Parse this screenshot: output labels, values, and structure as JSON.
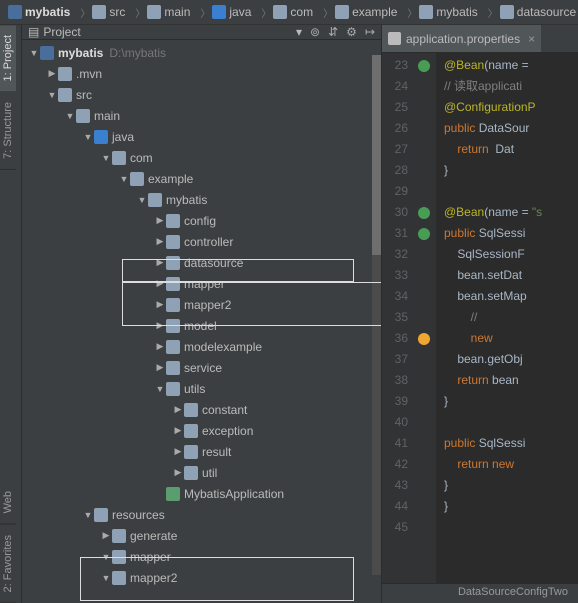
{
  "breadcrumbs": [
    "mybatis",
    "src",
    "main",
    "java",
    "com",
    "example",
    "mybatis",
    "datasource"
  ],
  "vtabs": {
    "project": "1: Project",
    "structure": "7: Structure",
    "web": "Web",
    "favorites": "2: Favorites"
  },
  "proj_toolbar": {
    "title": "Project",
    "dropdown": "▾"
  },
  "tree": {
    "root": "mybatis",
    "root_hint": "D:\\mybatis",
    "mvn": ".mvn",
    "src": "src",
    "main": "main",
    "java": "java",
    "com": "com",
    "example": "example",
    "mybatis": "mybatis",
    "config": "config",
    "controller": "controller",
    "datasource": "datasource",
    "mapper": "mapper",
    "mapper2": "mapper2",
    "model": "model",
    "modelexample": "modelexample",
    "service": "service",
    "utils": "utils",
    "constant": "constant",
    "exception": "exception",
    "result": "result",
    "util": "util",
    "app": "MybatisApplication",
    "resources": "resources",
    "generate": "generate",
    "rmapper": "mapper",
    "rmapper2": "mapper2"
  },
  "editor": {
    "tab": "application.properties",
    "lines_start": 23,
    "lines": [
      23,
      24,
      25,
      26,
      27,
      28,
      29,
      30,
      31,
      32,
      33,
      34,
      35,
      36,
      37,
      38,
      39,
      40,
      41,
      42,
      43,
      44,
      45
    ],
    "code": [
      {
        "seg": [
          [
            "@Bean",
            "k-ann"
          ],
          [
            "(",
            "k-id"
          ],
          [
            "name = ",
            "k-id"
          ]
        ]
      },
      {
        "seg": [
          [
            "// 读取applicati",
            "k-comm"
          ]
        ]
      },
      {
        "seg": [
          [
            "@ConfigurationP",
            "k-ann"
          ]
        ]
      },
      {
        "seg": [
          [
            "public ",
            "k-key"
          ],
          [
            "DataSour",
            "k-id"
          ]
        ]
      },
      {
        "seg": [
          [
            "    return  ",
            "k-key"
          ],
          [
            "Dat",
            "k-id"
          ]
        ]
      },
      {
        "seg": [
          [
            "}",
            "k-id"
          ]
        ]
      },
      {
        "seg": [
          [
            "",
            "k-id"
          ]
        ]
      },
      {
        "seg": [
          [
            "@Bean",
            "k-ann"
          ],
          [
            "(",
            "k-id"
          ],
          [
            "name = ",
            "k-id"
          ],
          [
            "\"s",
            "k-str"
          ]
        ]
      },
      {
        "seg": [
          [
            "public ",
            "k-key"
          ],
          [
            "SqlSessi",
            "k-id"
          ]
        ]
      },
      {
        "seg": [
          [
            "    SqlSessionF",
            "k-id"
          ]
        ]
      },
      {
        "seg": [
          [
            "    bean.setDat",
            "k-id"
          ]
        ]
      },
      {
        "seg": [
          [
            "    bean.setMap",
            "k-id"
          ]
        ]
      },
      {
        "seg": [
          [
            "        // ",
            "k-comm"
          ]
        ]
      },
      {
        "seg": [
          [
            "        new",
            "k-key"
          ]
        ]
      },
      {
        "seg": [
          [
            "    bean.getObj",
            "k-id"
          ]
        ]
      },
      {
        "seg": [
          [
            "    return ",
            "k-key"
          ],
          [
            "bean",
            "k-id"
          ]
        ]
      },
      {
        "seg": [
          [
            "}",
            "k-id"
          ]
        ]
      },
      {
        "seg": [
          [
            "",
            "k-id"
          ]
        ]
      },
      {
        "seg": [
          [
            "public ",
            "k-key"
          ],
          [
            "SqlSessi",
            "k-id"
          ]
        ]
      },
      {
        "seg": [
          [
            "    return new ",
            "k-key"
          ]
        ]
      },
      {
        "seg": [
          [
            "}",
            "k-id"
          ]
        ]
      },
      {
        "seg": [
          [
            "}",
            "k-id"
          ]
        ]
      },
      {
        "seg": [
          [
            "",
            "k-id"
          ]
        ]
      }
    ],
    "status": "DataSourceConfigTwo"
  }
}
